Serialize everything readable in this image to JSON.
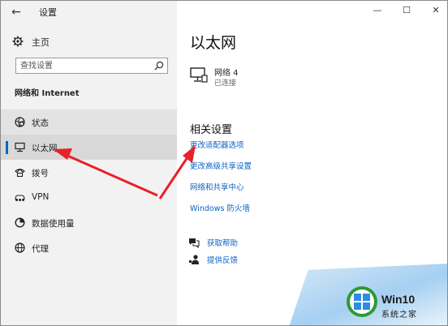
{
  "window": {
    "app_title": "设置",
    "controls": {
      "minimize": "—",
      "maximize": "☐",
      "close": "✕"
    }
  },
  "sidebar": {
    "home_label": "主页",
    "search_placeholder": "查找设置",
    "section_title": "网络和 Internet",
    "items": [
      {
        "label": "状态",
        "icon": "status-globe-icon"
      },
      {
        "label": "以太网",
        "icon": "ethernet-icon",
        "selected": true
      },
      {
        "label": "拨号",
        "icon": "dialup-icon"
      },
      {
        "label": "VPN",
        "icon": "vpn-icon"
      },
      {
        "label": "数据使用量",
        "icon": "data-usage-icon"
      },
      {
        "label": "代理",
        "icon": "proxy-globe-icon"
      }
    ]
  },
  "main": {
    "page_title": "以太网",
    "network": {
      "name": "网络 4",
      "status": "已连接",
      "icon": "network-computer-icon"
    },
    "related_title": "相关设置",
    "related_links": [
      "更改适配器选项",
      "更改高级共享设置",
      "网络和共享中心",
      "Windows 防火墙"
    ],
    "help": [
      {
        "label": "获取帮助",
        "icon": "help-chat-icon"
      },
      {
        "label": "提供反馈",
        "icon": "feedback-person-icon"
      }
    ]
  },
  "watermark": {
    "title": "Win10",
    "subtitle": "系统之家"
  },
  "colors": {
    "accent": "#0067c0",
    "link": "#0b63c5",
    "annotation_arrow": "#e8202a"
  }
}
